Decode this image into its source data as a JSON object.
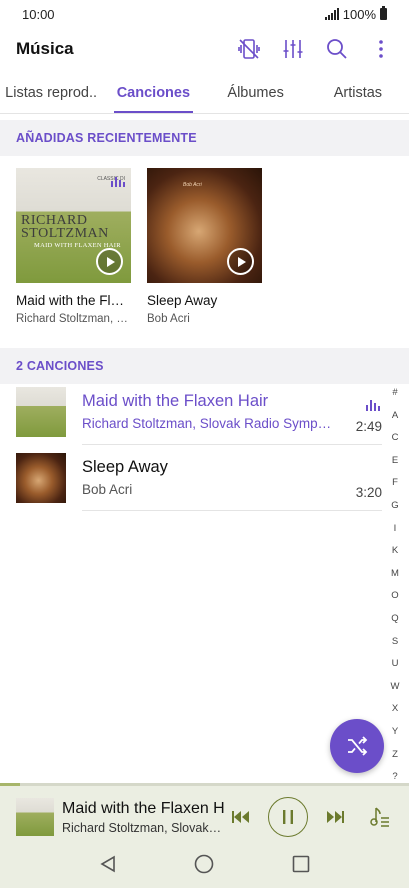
{
  "status": {
    "time": "10:00",
    "battery": "100%"
  },
  "app": {
    "title": "Música"
  },
  "toolbar": {
    "icons": [
      "vibrate-off-icon",
      "equalizer-icon",
      "search-icon",
      "more-vert-icon"
    ]
  },
  "tabs": [
    {
      "label": "Listas reprod..",
      "active": false
    },
    {
      "label": "Canciones",
      "active": true
    },
    {
      "label": "Álbumes",
      "active": false
    },
    {
      "label": "Artistas",
      "active": false
    }
  ],
  "recent": {
    "header": "AÑADIDAS RECIENTEMENTE",
    "items": [
      {
        "title": "Maid with the Flaxen Hair",
        "subtitle": "Richard Stoltzman, Slovak Radio Symphony",
        "cover_line1": "RICHARD",
        "cover_line2": "STOLTZMAN",
        "cover_line3": "MAID WITH FLAXEN HAIR",
        "cover_brand": "CLASSIC DI"
      },
      {
        "title": "Sleep Away",
        "subtitle": "Bob Acri",
        "cover_text": "Bob Acri"
      }
    ]
  },
  "songs": {
    "header": "2 CANCIONES",
    "items": [
      {
        "title": "Maid with the Flaxen Hair",
        "artist": "Richard Stoltzman, Slovak Radio Symphony Orchestra",
        "duration": "2:49",
        "playing": true
      },
      {
        "title": "Sleep Away",
        "artist": "Bob Acri",
        "duration": "3:20",
        "playing": false
      }
    ]
  },
  "alphabet": [
    "#",
    "A",
    "C",
    "E",
    "F",
    "G",
    "I",
    "K",
    "M",
    "O",
    "Q",
    "S",
    "U",
    "W",
    "X",
    "Y",
    "Z",
    "?"
  ],
  "now_playing": {
    "title": "Maid with the Flaxen Hair",
    "artist": "Richard Stoltzman, Slovak Radio Symphony Orchestra",
    "progress": 0.05
  },
  "colors": {
    "accent": "#6b4ec9",
    "player_bg": "#ebeee2",
    "player_accent": "#6b7a2d"
  }
}
